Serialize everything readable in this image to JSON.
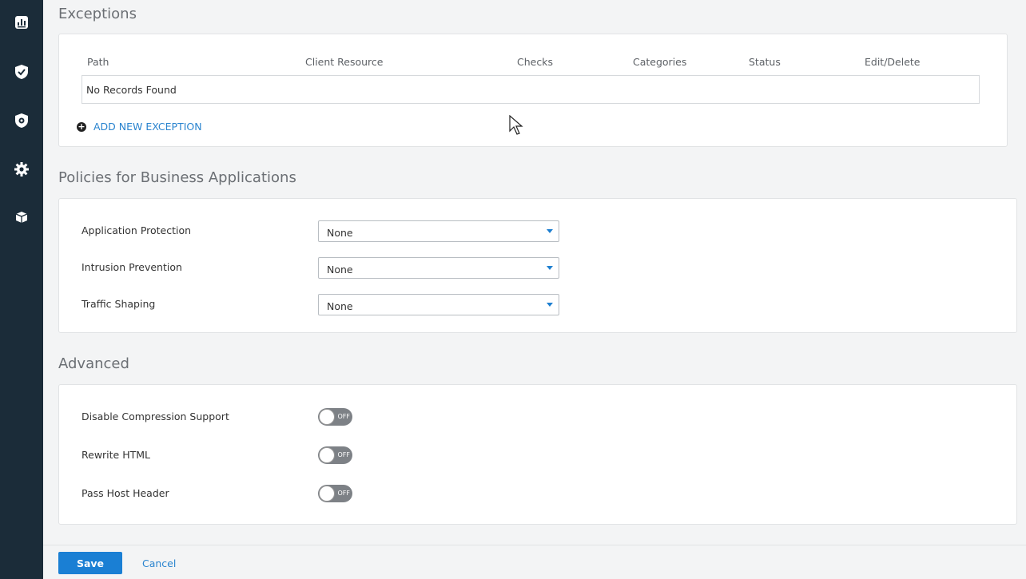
{
  "sidebar": {
    "icons": [
      "reports-icon",
      "shield-check-icon",
      "shield-gear-icon",
      "gear-icon",
      "box-icon"
    ]
  },
  "exceptions": {
    "title": "Exceptions",
    "columns": [
      "Path",
      "Client Resource",
      "Checks",
      "Categories",
      "Status",
      "Edit/Delete"
    ],
    "empty_text": "No Records Found",
    "add_label": "ADD NEW EXCEPTION"
  },
  "policies": {
    "title": "Policies for Business Applications",
    "fields": [
      {
        "label": "Application Protection",
        "value": "None"
      },
      {
        "label": "Intrusion Prevention",
        "value": "None"
      },
      {
        "label": "Traffic Shaping",
        "value": "None"
      }
    ]
  },
  "advanced": {
    "title": "Advanced",
    "toggles": [
      {
        "label": "Disable Compression Support",
        "state": "OFF"
      },
      {
        "label": "Rewrite HTML",
        "state": "OFF"
      },
      {
        "label": "Pass Host Header",
        "state": "OFF"
      }
    ]
  },
  "footer": {
    "save_label": "Save",
    "cancel_label": "Cancel"
  },
  "colors": {
    "sidebar": "#1b2c39",
    "accent": "#1a7fd4",
    "link": "#2a84cf"
  }
}
